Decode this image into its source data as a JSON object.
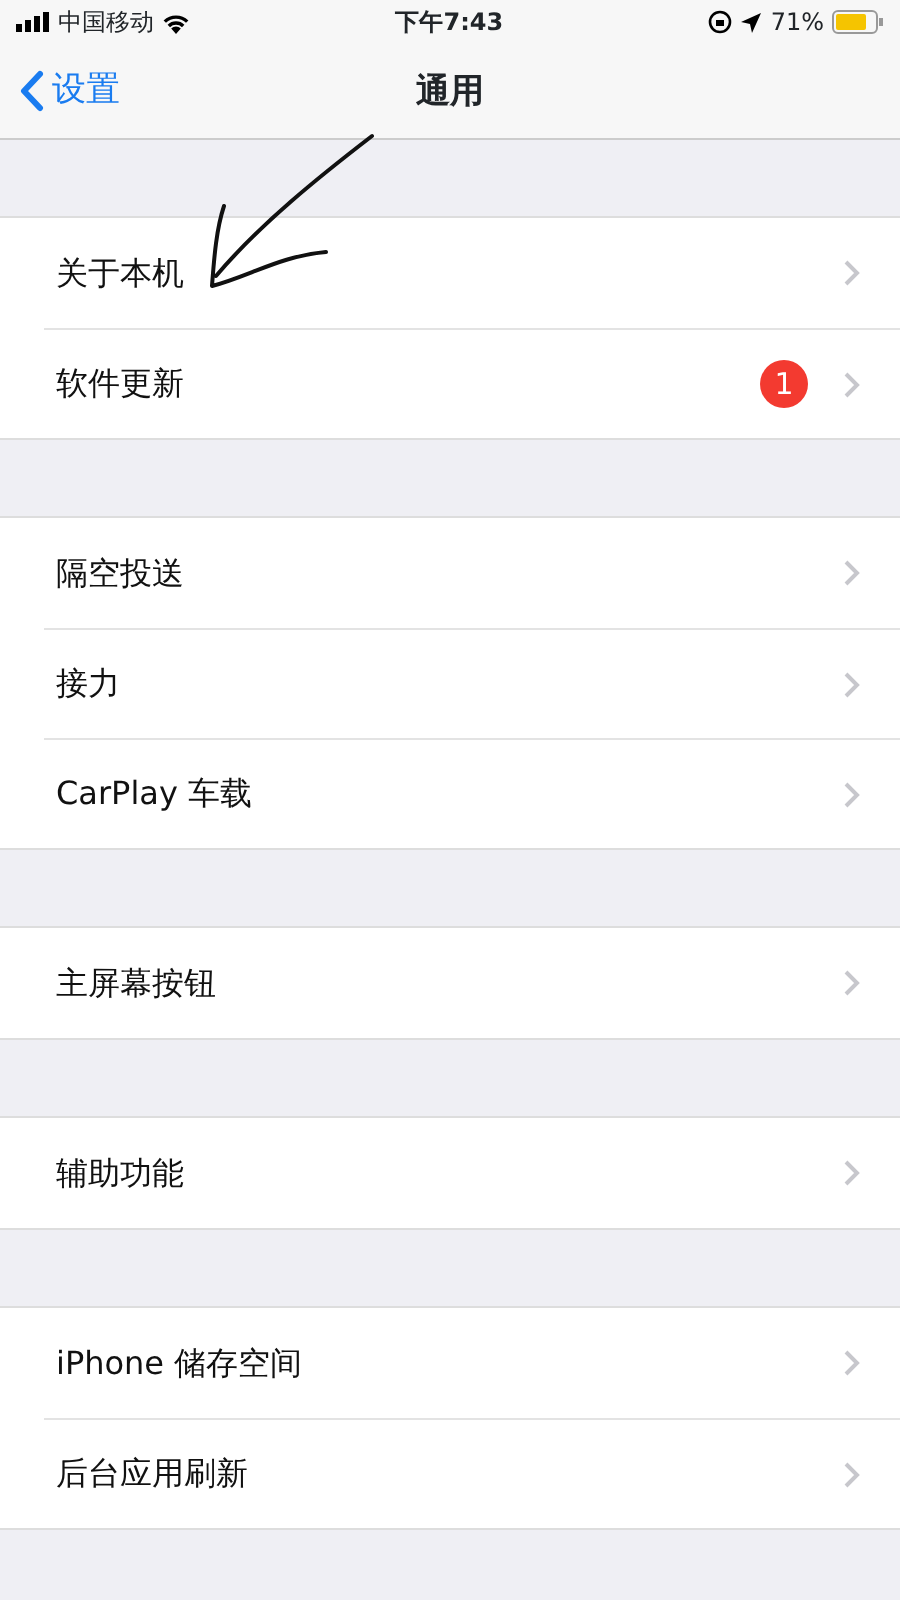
{
  "status_bar": {
    "carrier": "中国移动",
    "time": "下午7:43",
    "battery": "71%"
  },
  "nav": {
    "back": "设置",
    "title": "通用"
  },
  "groups": [
    {
      "items": [
        {
          "label": "关于本机"
        },
        {
          "label": "软件更新",
          "badge": "1"
        }
      ]
    },
    {
      "items": [
        {
          "label": "隔空投送"
        },
        {
          "label": "接力"
        },
        {
          "label": "CarPlay 车载"
        }
      ]
    },
    {
      "items": [
        {
          "label": "主屏幕按钮"
        }
      ]
    },
    {
      "items": [
        {
          "label": "辅助功能"
        }
      ]
    },
    {
      "items": [
        {
          "label": "iPhone 储存空间"
        },
        {
          "label": "后台应用刷新"
        }
      ]
    }
  ]
}
